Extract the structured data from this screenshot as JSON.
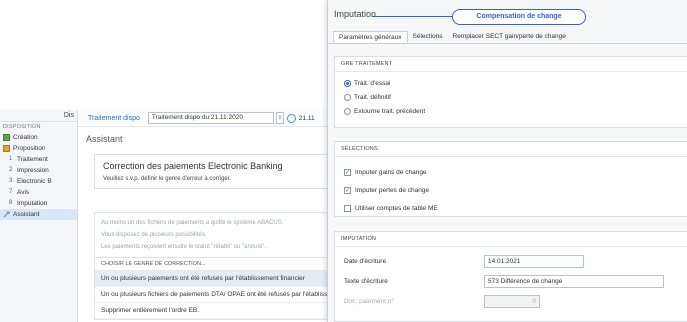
{
  "left_nav": {
    "title": "Dis",
    "section": "DISPOSITION",
    "items": [
      {
        "label": "Création",
        "icon": "create-icon"
      },
      {
        "label": "Proposition",
        "icon": "proposal-icon"
      }
    ],
    "sub_items": [
      {
        "num": "1",
        "label": "Traitement"
      },
      {
        "num": "2",
        "label": "Impression"
      },
      {
        "num": "3",
        "label": "Electronic B"
      },
      {
        "num": "7",
        "label": "Avis"
      },
      {
        "num": "8",
        "label": "Imputation"
      }
    ],
    "assistant": "Assistant"
  },
  "main": {
    "toolbar_label": "Traitement dispo",
    "toolbar_select": "Traitement dispo du 21.11.2020",
    "toolbar_time": "21.11",
    "assistant_title": "Assistant",
    "card_heading": "Correction des paiements Electronic Banking",
    "card_text": "Veuillez s.v.p. définir le genre d'erreur à corriger.",
    "info_lines": [
      "Au moins un des fichiers de paiements a quitté le système ABACUS.",
      "Vous disposez de plusieurs possibilités.",
      "Les paiements reçoivent ensuite le statut \"rétabli\" ou \"annulé\"."
    ],
    "choice_title": "CHOISIR LE GENRE DE CORRECTION...",
    "choices": [
      "Un ou plusieurs paiements ont été refusés par l'établissement financier",
      "Un ou plusieurs fichiers de paiements DTA/ OPAE ont été refusés par l'établissement",
      "Supprimer entièrement l'ordre EB."
    ]
  },
  "dialog": {
    "title": "Imputation",
    "callout": "Compensation de change",
    "tabs": [
      "Paramètres généraux",
      "Sélections",
      "Remplacer SECT gain/perte de change"
    ],
    "trait": {
      "title": "GRE TRAITEMENT",
      "options": [
        "Trait. d'essai",
        "Trait. définitif",
        "Extourne trait. précédent"
      ],
      "selected": 0
    },
    "selections": {
      "title": "SÉLECTIONS",
      "options": [
        {
          "label": "Imputer gains de change",
          "checked": true
        },
        {
          "label": "Imputer pertes de change",
          "checked": true
        },
        {
          "label": "Utiliser comptes de table ME",
          "checked": false
        }
      ]
    },
    "imputation": {
      "title": "IMPUTATION",
      "date_label": "Date d'écriture",
      "date_value": "14.01.2021",
      "text_label": "Texte d'écriture",
      "text_value": "573 Différence de change",
      "doc_label": "Doc. paiement n°",
      "doc_value": "0"
    }
  }
}
